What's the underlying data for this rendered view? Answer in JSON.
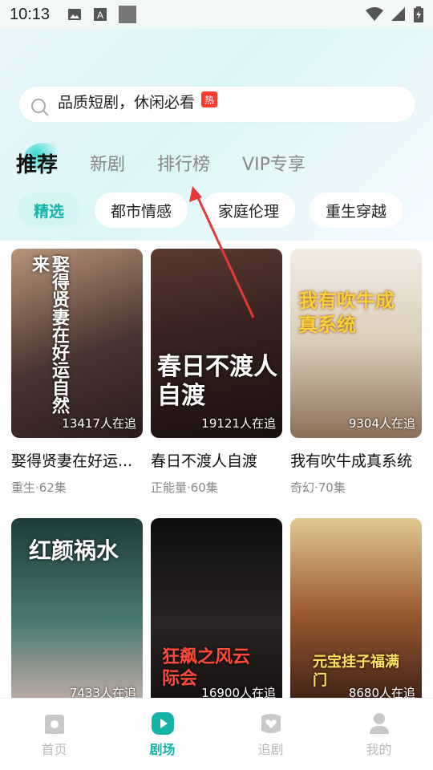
{
  "status": {
    "time": "10:13"
  },
  "search": {
    "placeholder": "品质短剧，休闲必看",
    "badge": "热"
  },
  "tabs": [
    {
      "label": "推荐",
      "active": true
    },
    {
      "label": "新剧",
      "active": false
    },
    {
      "label": "排行榜",
      "active": false
    },
    {
      "label": "VIP专享",
      "active": false
    }
  ],
  "chips": [
    {
      "label": "精选",
      "active": true
    },
    {
      "label": "都市情感",
      "active": false
    },
    {
      "label": "家庭伦理",
      "active": false
    },
    {
      "label": "重生穿越",
      "active": false
    }
  ],
  "dramas": [
    {
      "title": "娶得贤妻在好运...",
      "meta": "重生·62集",
      "watching": "13417人在追",
      "poster_text": "娶得贤妻在好运自然来",
      "colors": [
        "#3a2a2a",
        "#c9a58a"
      ]
    },
    {
      "title": "春日不渡人自渡",
      "meta": "正能量·60集",
      "watching": "19121人在追",
      "poster_text": "春日不渡人自渡",
      "colors": [
        "#2a1a1a",
        "#7a3a2a"
      ]
    },
    {
      "title": "我有吹牛成真系统",
      "meta": "奇幻·70集",
      "watching": "9304人在追",
      "poster_text": "我有吹牛成真系统",
      "colors": [
        "#d8cfc0",
        "#8a6e50"
      ]
    },
    {
      "title": "",
      "meta": "",
      "watching": "7433人在追",
      "poster_text": "红颜祸水",
      "colors": [
        "#1a3a3a",
        "#6aa8a0"
      ]
    },
    {
      "title": "",
      "meta": "",
      "watching": "16900人在追",
      "poster_text": "狂飙之风云际会",
      "colors": [
        "#111111",
        "#3a3030"
      ]
    },
    {
      "title": "",
      "meta": "",
      "watching": "8680人在追",
      "poster_text": "元宝挂子福满门",
      "colors": [
        "#4a2a1a",
        "#c88a40"
      ]
    }
  ],
  "nav": [
    {
      "label": "首页",
      "icon": "home-icon",
      "active": false
    },
    {
      "label": "剧场",
      "icon": "play-icon",
      "active": true
    },
    {
      "label": "追剧",
      "icon": "heart-icon",
      "active": false
    },
    {
      "label": "我的",
      "icon": "user-icon",
      "active": false
    }
  ],
  "colors": {
    "accent": "#16b3a8",
    "hot": "#ff3b30",
    "arrow": "#e53935"
  }
}
